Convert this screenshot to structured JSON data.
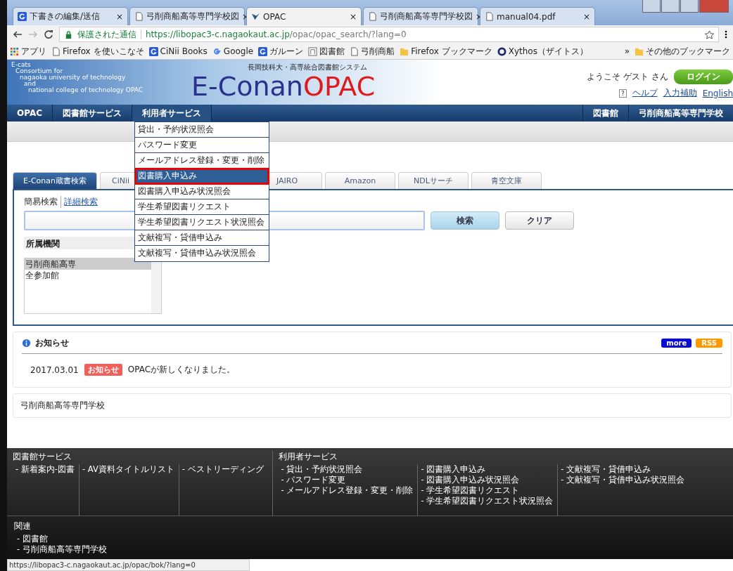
{
  "browser": {
    "tabs": [
      {
        "title": "下書きの編集/送信",
        "close": "×",
        "selected": false
      },
      {
        "title": "弓削商船高等専門学校図",
        "close": "×",
        "selected": false
      },
      {
        "title": "OPAC",
        "close": "×",
        "selected": true
      },
      {
        "title": "弓削商船高等専門学校図",
        "close": "×",
        "selected": false
      },
      {
        "title": "manual04.pdf",
        "close": "×",
        "selected": false
      }
    ],
    "address": {
      "secure_label": "保護された通信",
      "url_host": "https://libopac3-c.nagaokaut.ac.jp",
      "url_path": "/opac/opac_search/?lang=0"
    },
    "bookmarks": [
      {
        "label": "アプリ"
      },
      {
        "label": "Firefox を使いこなそ"
      },
      {
        "label": "CiNii Books"
      },
      {
        "label": "Google"
      },
      {
        "label": "ガルーン"
      },
      {
        "label": "図書館"
      },
      {
        "label": "弓削商船"
      },
      {
        "label": "Firefox ブックマーク"
      },
      {
        "label": "Xythos（ザイトス）"
      }
    ],
    "overflow": "»",
    "other_bookmarks": "その他のブックマーク"
  },
  "header": {
    "logo_lines": [
      "E-cats",
      "Consortium for",
      "nagaoka university of technology",
      "and",
      "national college of technology OPAC"
    ],
    "subtitle": "長岡技科大・高専統合図書館システム",
    "title_main": "E-Conan",
    "title_accent": "OPAC",
    "welcome": "ようこそ ゲスト さん",
    "login": "ログイン",
    "help_mark": "?",
    "links": [
      "ヘルプ",
      "入力補助",
      "English"
    ]
  },
  "nav": {
    "left": [
      {
        "label": "OPAC",
        "expanded": false
      },
      {
        "label": "図書館サービス",
        "expanded": false
      },
      {
        "label": "利用者サービス",
        "expanded": true
      }
    ],
    "right": [
      "図書館",
      "弓削商船高等専門学校"
    ]
  },
  "menu": [
    {
      "label": "貸出・予約状況照会",
      "selected": false
    },
    {
      "label": "パスワード変更",
      "selected": false
    },
    {
      "label": "メールアドレス登録・変更・削除",
      "selected": false
    },
    {
      "label": "図書購入申込み",
      "selected": true
    },
    {
      "label": "図書購入申込み状況照会",
      "selected": false
    },
    {
      "label": "学生希望図書リクエスト",
      "selected": false
    },
    {
      "label": "学生希望図書リクエスト状況照会",
      "selected": false
    },
    {
      "label": "文献複写・貸借申込み",
      "selected": false
    },
    {
      "label": "文献複写・貸借申込み状況照会",
      "selected": false
    }
  ],
  "search_tabs": [
    {
      "label": "E-Conan蔵書検索",
      "selected": true
    },
    {
      "label": "CiNii",
      "selected": false
    },
    {
      "label": "JAIRO",
      "selected": false
    },
    {
      "label": "Amazon",
      "selected": false
    },
    {
      "label": "NDLサーチ",
      "selected": false
    },
    {
      "label": "青空文庫",
      "selected": false
    }
  ],
  "search": {
    "modes": [
      {
        "label": "簡易検索",
        "selected": true
      },
      {
        "label": "詳細検索",
        "selected": false
      }
    ],
    "buttons": [
      {
        "label": "検索",
        "kind": "primary"
      },
      {
        "label": "クリア",
        "kind": "plain"
      }
    ],
    "filter_label": "所属機関",
    "options": [
      {
        "label": "弓削商船高専",
        "selected": true
      },
      {
        "label": "全参加館",
        "selected": false
      }
    ]
  },
  "news": {
    "title": "お知らせ",
    "more": "more",
    "rss": "RSS",
    "items": [
      {
        "date": "2017.03.01",
        "badge": "お知らせ",
        "text": "OPACが新しくなりました。"
      }
    ]
  },
  "library_box": "弓削商船高等専門学校",
  "footer": {
    "sections": [
      {
        "title": "図書館サービス",
        "columns": [
          [
            "- 新着案内-図書"
          ],
          [
            "- AV資料タイトルリスト"
          ],
          [
            "- ベストリーディング"
          ]
        ]
      },
      {
        "title": "利用者サービス",
        "columns": [
          [
            "- 貸出・予約状況照会",
            "- パスワード変更",
            "- メールアドレス登録・変更・削除"
          ],
          [
            "- 図書購入申込み",
            "- 図書購入申込み状況照会",
            "- 学生希望図書リクエスト",
            "- 学生希望図書リクエスト状況照会"
          ],
          [
            "- 文献複写・貸借申込み",
            "- 文献複写・貸借申込み状況照会"
          ]
        ]
      }
    ],
    "related_title": "関連",
    "related": [
      "- 図書館",
      "- 弓削商船高等専門学校"
    ]
  },
  "status_url": "https://libopac3-c.nagaokaut.ac.jp/opac/bok/?lang=0"
}
